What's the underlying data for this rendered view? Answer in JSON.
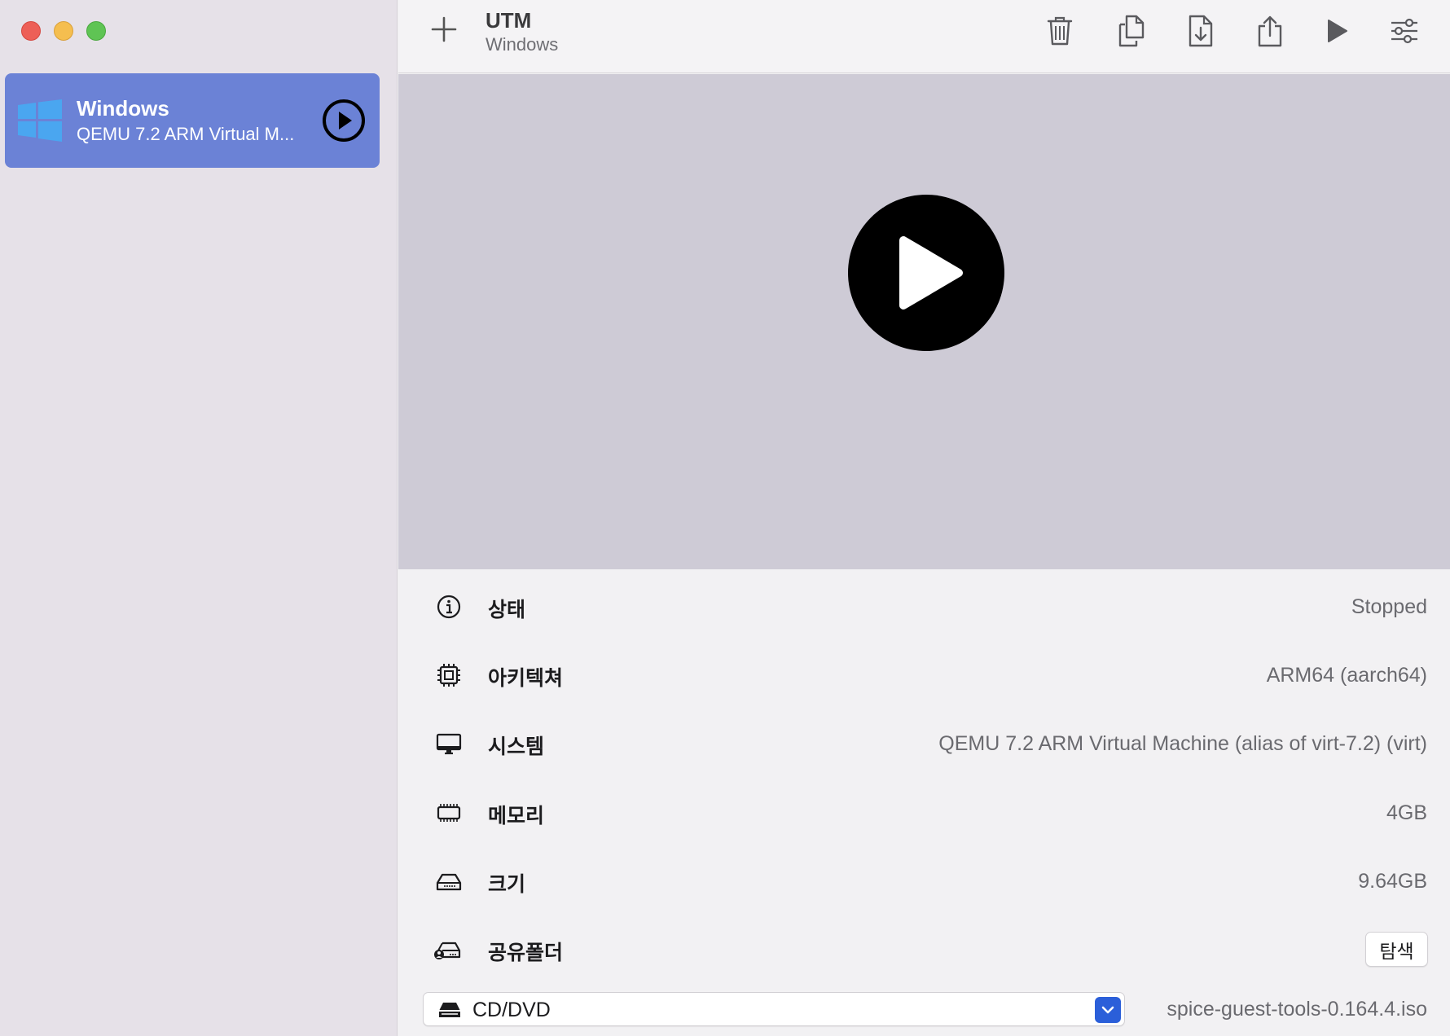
{
  "window": {
    "traffic_lights": [
      "close",
      "minimize",
      "zoom"
    ]
  },
  "sidebar": {
    "vm": {
      "name": "Windows",
      "description": "QEMU 7.2 ARM Virtual M...",
      "logo_icon": "windows-logo-icon",
      "play_icon": "play-circle-icon",
      "selected_color": "#6b82d6"
    }
  },
  "toolbar": {
    "app_title": "UTM",
    "subtitle": "Windows",
    "buttons": [
      "add-icon",
      "trash-icon",
      "clone-icon",
      "import-icon",
      "share-icon",
      "play-icon",
      "settings-sliders-icon"
    ]
  },
  "preview": {
    "play_icon": "play-large-icon"
  },
  "details": {
    "status": {
      "label": "상태",
      "value": "Stopped",
      "icon": "info-icon"
    },
    "architecture": {
      "label": "아키텍쳐",
      "value": "ARM64 (aarch64)",
      "icon": "cpu-icon"
    },
    "system": {
      "label": "시스템",
      "value": "QEMU 7.2 ARM Virtual Machine (alias of virt-7.2) (virt)",
      "icon": "monitor-icon"
    },
    "memory": {
      "label": "메모리",
      "value": "4GB",
      "icon": "memory-icon"
    },
    "size": {
      "label": "크기",
      "value": "9.64GB",
      "icon": "drive-icon"
    },
    "shared_folder": {
      "label": "공유폴더",
      "button": "탐색",
      "icon": "shared-drive-icon"
    }
  },
  "cd_dvd": {
    "selected": "CD/DVD",
    "file": "spice-guest-tools-0.164.4.iso",
    "icon": "disc-drive-icon",
    "accent": "#2b5fd9"
  }
}
